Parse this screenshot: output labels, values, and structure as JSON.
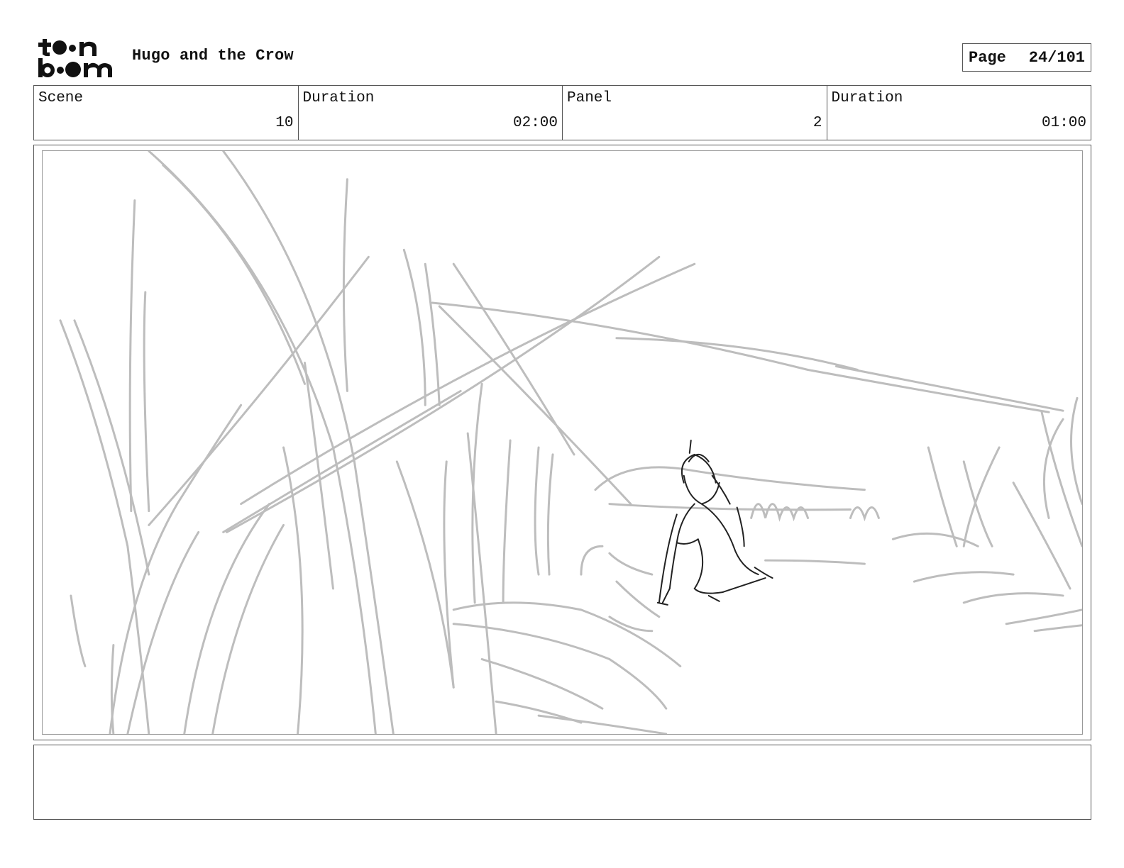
{
  "header": {
    "logo_icon": "toon-boom-logo",
    "logo_text": "toon boom",
    "project_title": "Hugo and the Crow",
    "page_label": "Page",
    "page_number": "24/101"
  },
  "info": {
    "scene_label": "Scene",
    "scene_value": "10",
    "scene_duration_label": "Duration",
    "scene_duration_value": "02:00",
    "panel_label": "Panel",
    "panel_value": "2",
    "panel_duration_label": "Duration",
    "panel_duration_value": "01:00"
  },
  "panel": {
    "image_icon": "storyboard-sketch-forest-kneeling-boy"
  },
  "notes": {
    "text": ""
  }
}
